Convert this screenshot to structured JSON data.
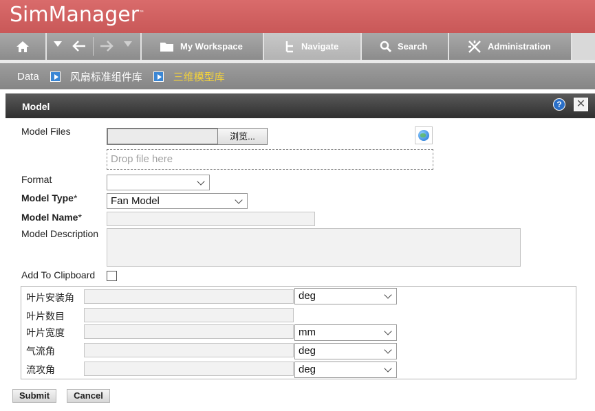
{
  "app": {
    "logo": "SimManager",
    "logo_mark": "™"
  },
  "nav": {
    "home_icon": "home-icon",
    "workspace": "My Workspace",
    "navigate": "Navigate",
    "search": "Search",
    "administration": "Administration"
  },
  "breadcrumb": {
    "root": "Data",
    "level1": "风扇标准组件库",
    "level2": "三维模型库"
  },
  "panel": {
    "title": "Model",
    "help": "?",
    "close": "✕"
  },
  "form": {
    "model_files_label": "Model Files",
    "browse_label": "浏览...",
    "drop_placeholder": "Drop file here",
    "format_label": "Format",
    "format_value": "",
    "model_type_label": "Model Type",
    "model_type_value": "Fan Model",
    "required_mark": "*",
    "model_name_label": "Model Name",
    "model_name_value": "",
    "model_description_label": "Model Description",
    "model_description_value": "",
    "add_to_clipboard_label": "Add To Clipboard",
    "add_to_clipboard_checked": false
  },
  "params": [
    {
      "label": "叶片安装角",
      "value": "",
      "unit": "deg"
    },
    {
      "label": "叶片数目",
      "value": "",
      "unit": null
    },
    {
      "label": "叶片宽度",
      "value": "",
      "unit": "mm"
    },
    {
      "label": "气流角",
      "value": "",
      "unit": "deg"
    },
    {
      "label": "流攻角",
      "value": "",
      "unit": "deg"
    }
  ],
  "actions": {
    "submit": "Submit",
    "cancel": "Cancel"
  },
  "colors": {
    "header": "#cd5d5d",
    "accent_text": "#f3d23a",
    "link_blue": "#3a86d4"
  }
}
